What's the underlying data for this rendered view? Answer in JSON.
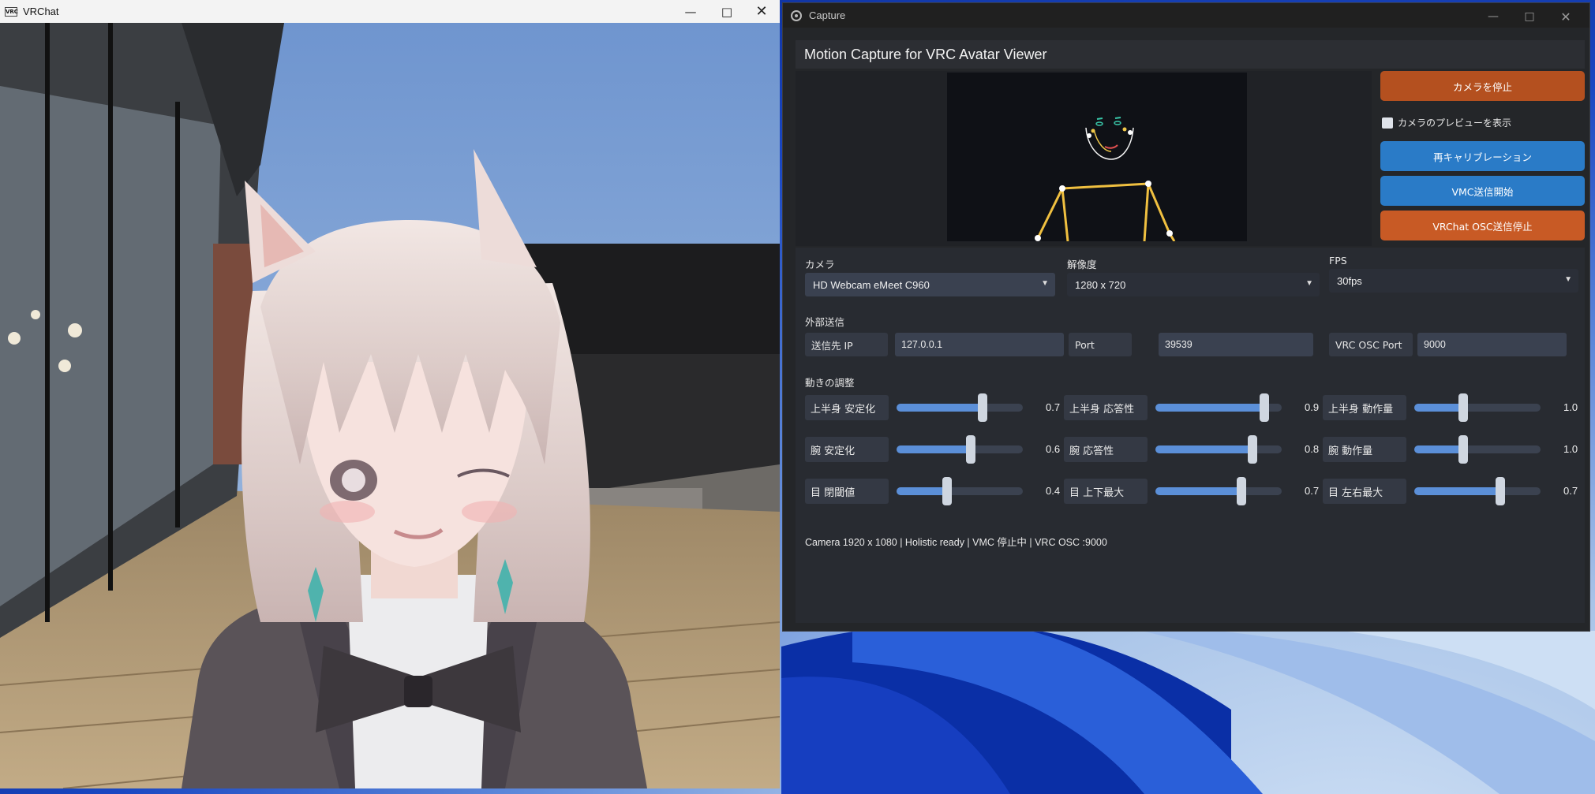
{
  "vrchat_window": {
    "title": "VRChat",
    "icon_text": "VRC"
  },
  "capture_window": {
    "title": "Capture",
    "app_title": "Motion Capture for VRC Avatar Viewer",
    "buttons": {
      "stop_camera": "カメラを停止",
      "recalibrate": "再キャリブレーション",
      "vmc_start": "VMC送信開始",
      "vrchat_osc_stop": "VRChat OSC送信停止"
    },
    "preview_checkbox": {
      "label": "カメラのプレビューを表示",
      "checked": false
    },
    "camera": {
      "label": "カメラ",
      "value": "HD Webcam eMeet C960"
    },
    "resolution": {
      "label": "解像度",
      "value": "1280 x 720"
    },
    "fps": {
      "label": "FPS",
      "value": "30fps"
    },
    "external": {
      "label": "外部送信",
      "ip_label": "送信先 IP",
      "ip_value": "127.0.0.1",
      "port_label": "Port",
      "port_value": "39539",
      "osc_port_label": "VRC OSC Port",
      "osc_port_value": "9000"
    },
    "motion_section_label": "動きの調整",
    "sliders": [
      {
        "label": "上半身 安定化",
        "value": "0.7",
        "fraction": 0.68
      },
      {
        "label": "上半身 応答性",
        "value": "0.9",
        "fraction": 0.86
      },
      {
        "label": "上半身 動作量",
        "value": "1.0",
        "fraction": 0.39
      },
      {
        "label": "腕 安定化",
        "value": "0.6",
        "fraction": 0.59
      },
      {
        "label": "腕 応答性",
        "value": "0.8",
        "fraction": 0.77
      },
      {
        "label": "腕 動作量",
        "value": "1.0",
        "fraction": 0.39
      },
      {
        "label": "目 閉閾値",
        "value": "0.4",
        "fraction": 0.4
      },
      {
        "label": "目 上下最大",
        "value": "0.7",
        "fraction": 0.68
      },
      {
        "label": "目 左右最大",
        "value": "0.7",
        "fraction": 0.68
      }
    ],
    "status": "Camera 1920 x 1080 | Holistic ready | VMC 停止中 | VRC OSC :9000"
  }
}
